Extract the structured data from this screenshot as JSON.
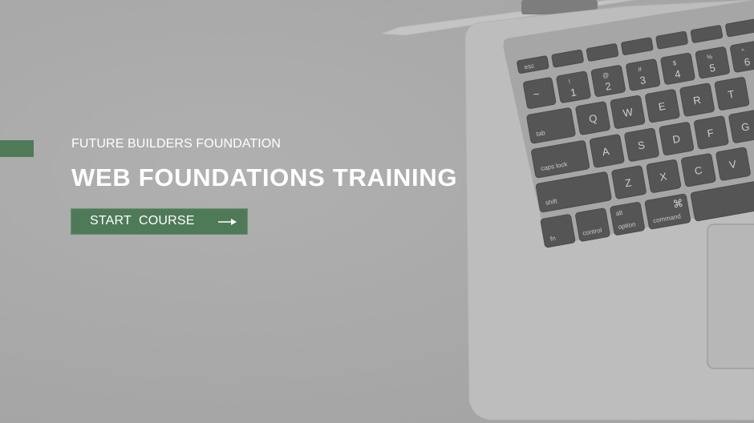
{
  "hero": {
    "organization": "FUTURE BUILDERS FOUNDATION",
    "title": "WEB FOUNDATIONS TRAINING",
    "cta_label": "START  COURSE",
    "cta_icon": "arrow-right-icon"
  },
  "background": {
    "image": "laptop-keyboard-photo",
    "keys": {
      "esc": "esc",
      "tab": "tab",
      "caps": "caps lock",
      "shift": "shift",
      "fn": "fn",
      "control": "control",
      "option": "option",
      "alt": "alt",
      "command": "command",
      "cmd_symbol": "⌘",
      "q": "Q",
      "w": "W",
      "e": "E",
      "r": "R",
      "t": "T",
      "a": "A",
      "s": "S",
      "d": "D",
      "f": "F",
      "g": "G",
      "z": "Z",
      "x": "X",
      "c": "C",
      "v": "V",
      "n1": "1",
      "n2": "2",
      "n3": "3",
      "n4": "4",
      "n5": "5",
      "n6": "6",
      "s1": "!",
      "s2": "@",
      "s3": "#",
      "s4": "$",
      "s5": "%",
      "s6": "^",
      "tilde": "~"
    }
  },
  "colors": {
    "accent": "#4f7a58",
    "overlay": "#a9a9a9",
    "text": "#ffffff"
  }
}
